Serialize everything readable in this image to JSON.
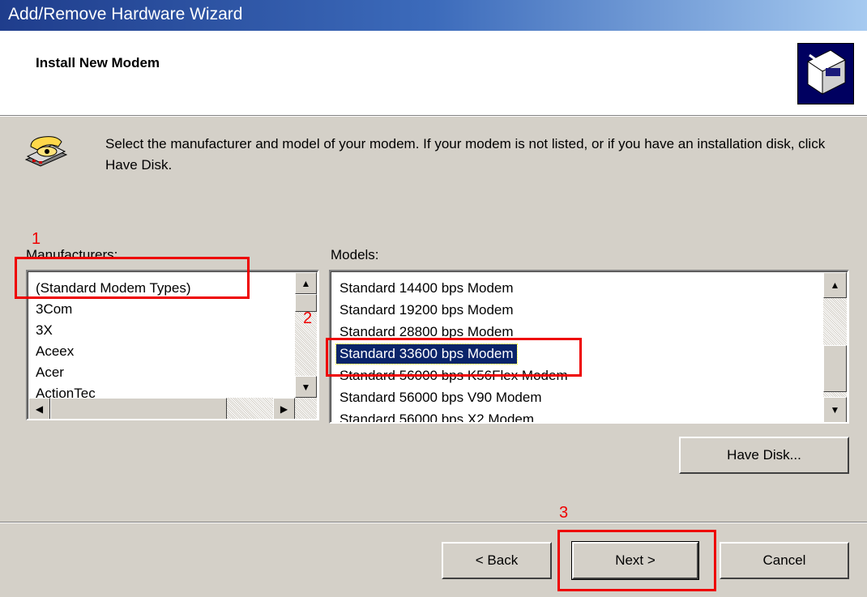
{
  "window": {
    "title": "Add/Remove Hardware Wizard"
  },
  "header": {
    "title": "Install New Modem",
    "icon": "hardware-wizard-icon"
  },
  "instructions": {
    "icon": "telephone-modem-icon",
    "text": "Select the manufacturer and model of your modem. If your modem is not listed, or if you have an installation disk, click Have Disk."
  },
  "manufacturers": {
    "label": "Manufacturers:",
    "items": [
      "(Standard Modem Types)",
      "3Com",
      "3X",
      "Aceex",
      "Acer",
      "ActionTec"
    ],
    "selected": "(Standard Modem Types)"
  },
  "models": {
    "label": "Models:",
    "items": [
      "Standard 14400 bps Modem",
      "Standard 19200 bps Modem",
      "Standard 28800 bps Modem",
      "Standard 33600 bps Modem",
      "Standard 56000 bps K56Flex Modem",
      "Standard 56000 bps V90 Modem",
      "Standard 56000 bps X2 Modem"
    ],
    "selected": "Standard 33600 bps Modem"
  },
  "buttons": {
    "have_disk": "Have Disk...",
    "back": "< Back",
    "next": "Next >",
    "cancel": "Cancel"
  },
  "annotations": {
    "step1": "1",
    "step2": "2",
    "step3": "3",
    "color": "#e00000"
  }
}
